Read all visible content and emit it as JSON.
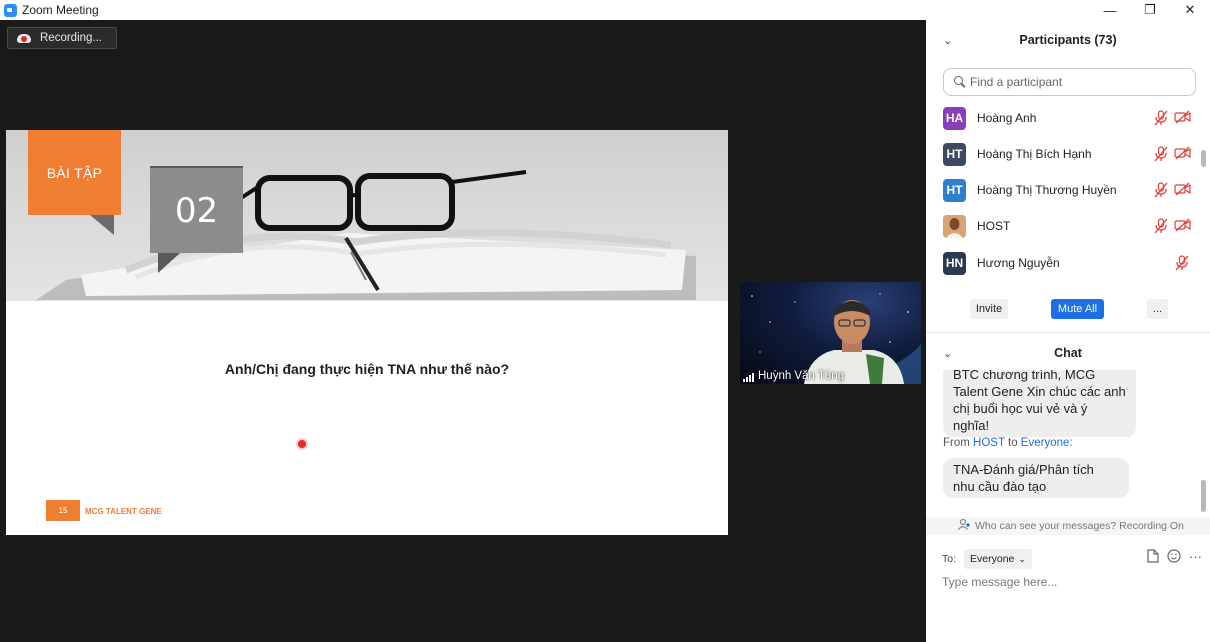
{
  "window": {
    "title": "Zoom Meeting",
    "minimize": "—",
    "maximize": "❐",
    "close": "✕"
  },
  "recording": {
    "label": "Recording..."
  },
  "slide": {
    "badge": "BÀI TẬP",
    "number": "02",
    "question": "Anh/Chị đang thực hiện TNA như thế nào?",
    "page": "15",
    "brand": "MCG TALENT GENE"
  },
  "video": {
    "name": "Huỳnh Văn Tùng"
  },
  "participants": {
    "title": "Participants (73)",
    "chevron": "⌄",
    "search_placeholder": "Find a participant",
    "items": [
      {
        "initials": "HA",
        "name": "Hoàng Anh",
        "color": "#8a3fb8",
        "mic_muted": true,
        "video_off": true
      },
      {
        "initials": "HT",
        "name": "Hoàng Thị Bích Hạnh",
        "color": "#3b4a5f",
        "mic_muted": true,
        "video_off": true
      },
      {
        "initials": "HT",
        "name": "Hoàng Thị Thương Huyền",
        "color": "#2f7fcf",
        "mic_muted": true,
        "video_off": true
      },
      {
        "initials": "",
        "name": "HOST",
        "color": "#c7884e",
        "mic_muted": true,
        "video_off": true
      },
      {
        "initials": "HN",
        "name": "Hương Nguyễn",
        "color": "#2c3a4f",
        "mic_muted": true,
        "video_off": false
      }
    ],
    "invite": "Invite",
    "mute_all": "Mute All",
    "more": "..."
  },
  "chat": {
    "title": "Chat",
    "chevron": "⌄",
    "msg1": "BTC chương trình, MCG Talent Gene Xin chúc các anh chị buổi học vui vẻ và ý nghĩa!",
    "from_prefix": "From",
    "from_sender": "HOST",
    "from_mid": "to",
    "from_target": "Everyone:",
    "msg2": "TNA-Đánh giá/Phân tích nhu cầu đào tạo",
    "notice": "Who can see your messages? Recording On",
    "to_label": "To:",
    "to_value": "Everyone",
    "placeholder": "Type message here...",
    "more": "···"
  }
}
